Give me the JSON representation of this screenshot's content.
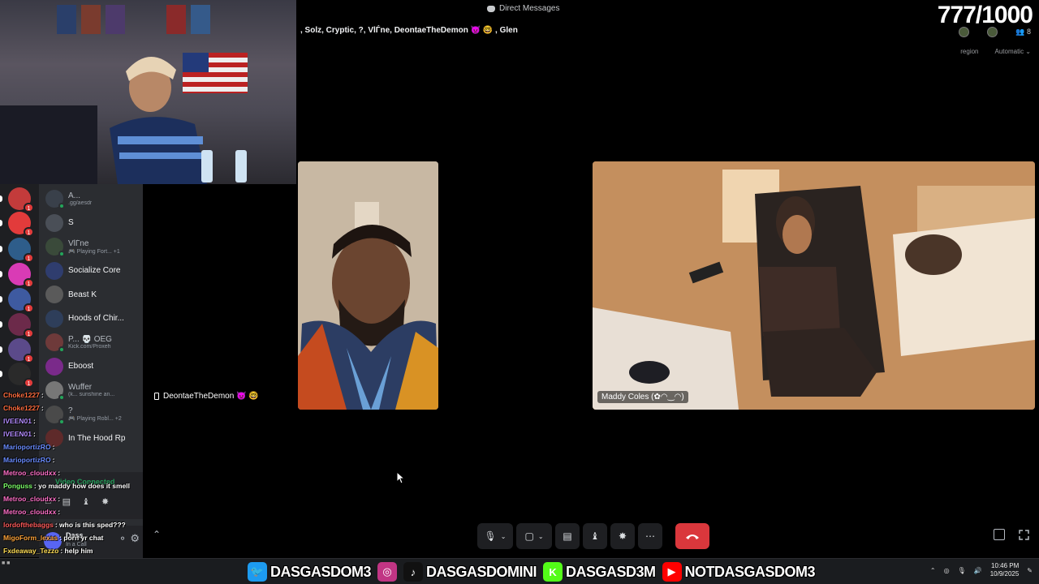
{
  "header": {
    "title": "Direct Messages",
    "participants": ", Solz, Cryptic, ?, VlЃne, DeontaeTheDemon 👿 🤓 , Glen",
    "region_label": "region",
    "region_value": "Automatic ⌄",
    "participant_count": "8"
  },
  "stream": {
    "viewer_count": "777/1000"
  },
  "sidebar": {
    "dms": [
      {
        "name": "A...",
        "sub": ".gg/aesdr"
      },
      {
        "name": "S",
        "sub": ""
      },
      {
        "name": "VlЃne",
        "sub": "🎮 Playing Fort... +1"
      },
      {
        "name": "Socialize Core",
        "sub": ""
      },
      {
        "name": "Beast K",
        "sub": ""
      },
      {
        "name": "Hoods of Chir...",
        "sub": ""
      },
      {
        "name": "P... 💀 OEG",
        "sub": "Kick.com/Proxeh"
      },
      {
        "name": "Eboost",
        "sub": ""
      },
      {
        "name": "Wuffer",
        "sub": "(k... sunshine an..."
      },
      {
        "name": "?",
        "sub": "🎮 Playing Robl... +2"
      },
      {
        "name": "In The Hood Rp",
        "sub": ""
      }
    ],
    "voice_status": "Video Connected",
    "user_name": "Dass",
    "user_status": "In a Call"
  },
  "chat": [
    {
      "user": "Choke1227",
      "msg": ":",
      "color": "#ff6b3d"
    },
    {
      "user": "Choke1227",
      "msg": ":",
      "color": "#ff6b3d"
    },
    {
      "user": "IVEEN01",
      "msg": ":",
      "color": "#b48cff"
    },
    {
      "user": "IVEEN01",
      "msg": ":",
      "color": "#b48cff"
    },
    {
      "user": "MarioportizRO",
      "msg": ":",
      "color": "#6a8cff"
    },
    {
      "user": "MarioportizRO",
      "msg": ":",
      "color": "#6a8cff"
    },
    {
      "user": "Metroo_cloudxx",
      "msg": ":",
      "color": "#ff70c8"
    },
    {
      "user": "Ponguss",
      "msg": ": yo maddy how does it smell",
      "color": "#7dff6a"
    },
    {
      "user": "Metroo_cloudxx",
      "msg": ":",
      "color": "#ff70c8"
    },
    {
      "user": "Metroo_cloudxx",
      "msg": ":",
      "color": "#ff70c8"
    },
    {
      "user": "lordofthebaggs",
      "msg": ": who is this sped???",
      "color": "#ff5b5b"
    },
    {
      "user": "MigoForm_lexas",
      "msg": ": porn yr chat",
      "color": "#ffa43a"
    },
    {
      "user": "Fxdeaway_Tezzo",
      "msg": ": help him",
      "color": "#ffdd55"
    }
  ],
  "tiles": {
    "empty_name": "DeontaeTheDemon 👿 🤓",
    "maddy_name": "Maddy Coles (✿◠‿◠)"
  },
  "socials": [
    {
      "icon": "twitter-icon",
      "glyph": "🐦",
      "color": "#1d9bf0",
      "text": "DASGASDOM3"
    },
    {
      "icon": "instagram-icon",
      "glyph": "◎",
      "color": "#c13584",
      "text": ""
    },
    {
      "icon": "tiktok-icon",
      "glyph": "♪",
      "color": "#111111",
      "text": "DASGASDOMINI"
    },
    {
      "icon": "kick-icon",
      "glyph": "K",
      "color": "#53fc18",
      "text": "DASGASD3M"
    },
    {
      "icon": "youtube-icon",
      "glyph": "▶",
      "color": "#ff0000",
      "text": "NOTDASGASDOM3"
    }
  ],
  "clock": {
    "time": "10:46 PM",
    "date": "10/9/2025"
  },
  "colors": {
    "hangup": "#da373c",
    "discord_bg": "#2b2d31",
    "rail_bg": "#1e1f22"
  }
}
